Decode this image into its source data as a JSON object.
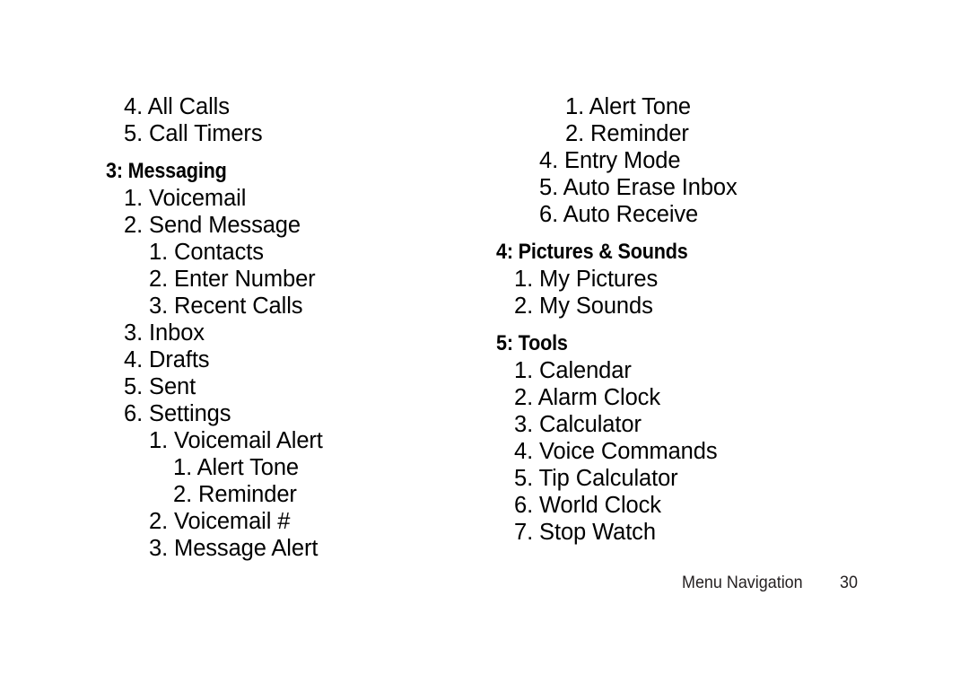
{
  "document": {
    "type": "phone-manual-menu-tree",
    "page_number": "30",
    "footer_label": "Menu Navigation",
    "text_color": "#000000",
    "background_color": "#ffffff"
  },
  "left_column": {
    "blocks": [
      {
        "kind": "items",
        "items": [
          {
            "level": 1,
            "text": "4. All Calls"
          },
          {
            "level": 1,
            "text": "5. Call Timers"
          }
        ]
      },
      {
        "kind": "section",
        "heading": "3: Messaging",
        "items": [
          {
            "level": 1,
            "text": "1. Voicemail"
          },
          {
            "level": 1,
            "text": "2. Send Message"
          },
          {
            "level": 2,
            "text": "1. Contacts"
          },
          {
            "level": 2,
            "text": "2. Enter Number"
          },
          {
            "level": 2,
            "text": "3. Recent Calls"
          },
          {
            "level": 1,
            "text": "3. Inbox"
          },
          {
            "level": 1,
            "text": "4. Drafts"
          },
          {
            "level": 1,
            "text": "5. Sent"
          },
          {
            "level": 1,
            "text": "6. Settings"
          },
          {
            "level": 2,
            "text": "1. Voicemail Alert"
          },
          {
            "level": 3,
            "text": "1. Alert Tone"
          },
          {
            "level": 3,
            "text": "2. Reminder"
          },
          {
            "level": 2,
            "text": "2. Voicemail #"
          },
          {
            "level": 2,
            "text": "3. Message Alert"
          }
        ]
      }
    ]
  },
  "right_column": {
    "blocks": [
      {
        "kind": "items",
        "items": [
          {
            "level": 3,
            "text": "1. Alert Tone"
          },
          {
            "level": 3,
            "text": "2. Reminder"
          },
          {
            "level": 2,
            "text": "4. Entry Mode"
          },
          {
            "level": 2,
            "text": "5. Auto Erase Inbox"
          },
          {
            "level": 2,
            "text": "6. Auto Receive"
          }
        ]
      },
      {
        "kind": "section",
        "heading": "4: Pictures & Sounds",
        "items": [
          {
            "level": 1,
            "text": "1. My Pictures"
          },
          {
            "level": 1,
            "text": "2. My Sounds"
          }
        ]
      },
      {
        "kind": "section",
        "heading": "5: Tools",
        "items": [
          {
            "level": 1,
            "text": "1. Calendar"
          },
          {
            "level": 1,
            "text": "2. Alarm Clock"
          },
          {
            "level": 1,
            "text": "3. Calculator"
          },
          {
            "level": 1,
            "text": "4. Voice Commands"
          },
          {
            "level": 1,
            "text": "5. Tip Calculator"
          },
          {
            "level": 1,
            "text": "6. World Clock"
          },
          {
            "level": 1,
            "text": "7. Stop Watch"
          }
        ]
      }
    ]
  }
}
